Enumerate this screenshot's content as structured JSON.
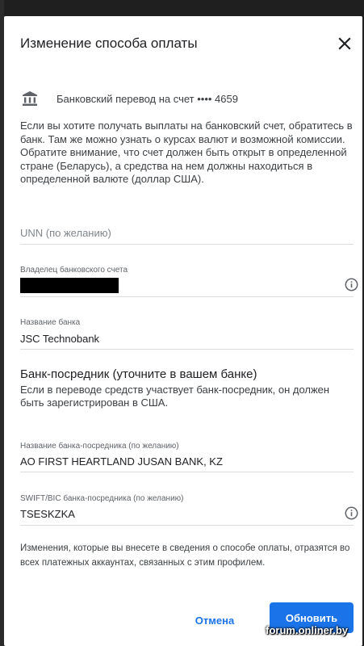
{
  "dialog": {
    "title": "Изменение способа оплаты",
    "close_icon": "close-icon"
  },
  "bank_account": {
    "icon": "bank-icon",
    "label": "Банковский перевод на счет •••• 4659"
  },
  "info_text": "Если вы хотите получать выплаты на банковский счет, обратитесь в банк. Там же можно узнать о курсах валют и возможной комиссии. Обратите внимание, что счет должен быть открыт в определенной стране (Беларусь), а средства на нем должны находиться в определенной валюте (доллар США).",
  "fields": {
    "unn": {
      "placeholder": "UNN (по желанию)",
      "value": ""
    },
    "owner": {
      "label": "Владелец банковского счета",
      "value": "",
      "info_icon": "info-icon"
    },
    "bank_name": {
      "label": "Название банка",
      "value": "JSC Technobank"
    },
    "intermediary_name": {
      "label": "Название банка-посредника (по желанию)",
      "value": "AO FIRST HEARTLAND JUSAN BANK, KZ"
    },
    "intermediary_swift": {
      "label": "SWIFT/BIC банка-посредника (по желанию)",
      "value": "TSESKZKA",
      "info_icon": "info-icon"
    }
  },
  "intermediary_section": {
    "title": "Банк-посредник (уточните в вашем банке)",
    "text": "Если в переводе средств участвует банк-посредник, он должен быть зарегистрирован в США."
  },
  "footer_note": "Изменения, которые вы внесете в сведения о способе оплаты, отразятся во всех платежных аккаунтах, связанных с этим профилем.",
  "buttons": {
    "cancel": "Отмена",
    "update": "Обновить"
  },
  "watermark": "forum.onliner.by",
  "colors": {
    "accent": "#1a73e8",
    "text": "#202124",
    "muted": "#5f6368"
  }
}
